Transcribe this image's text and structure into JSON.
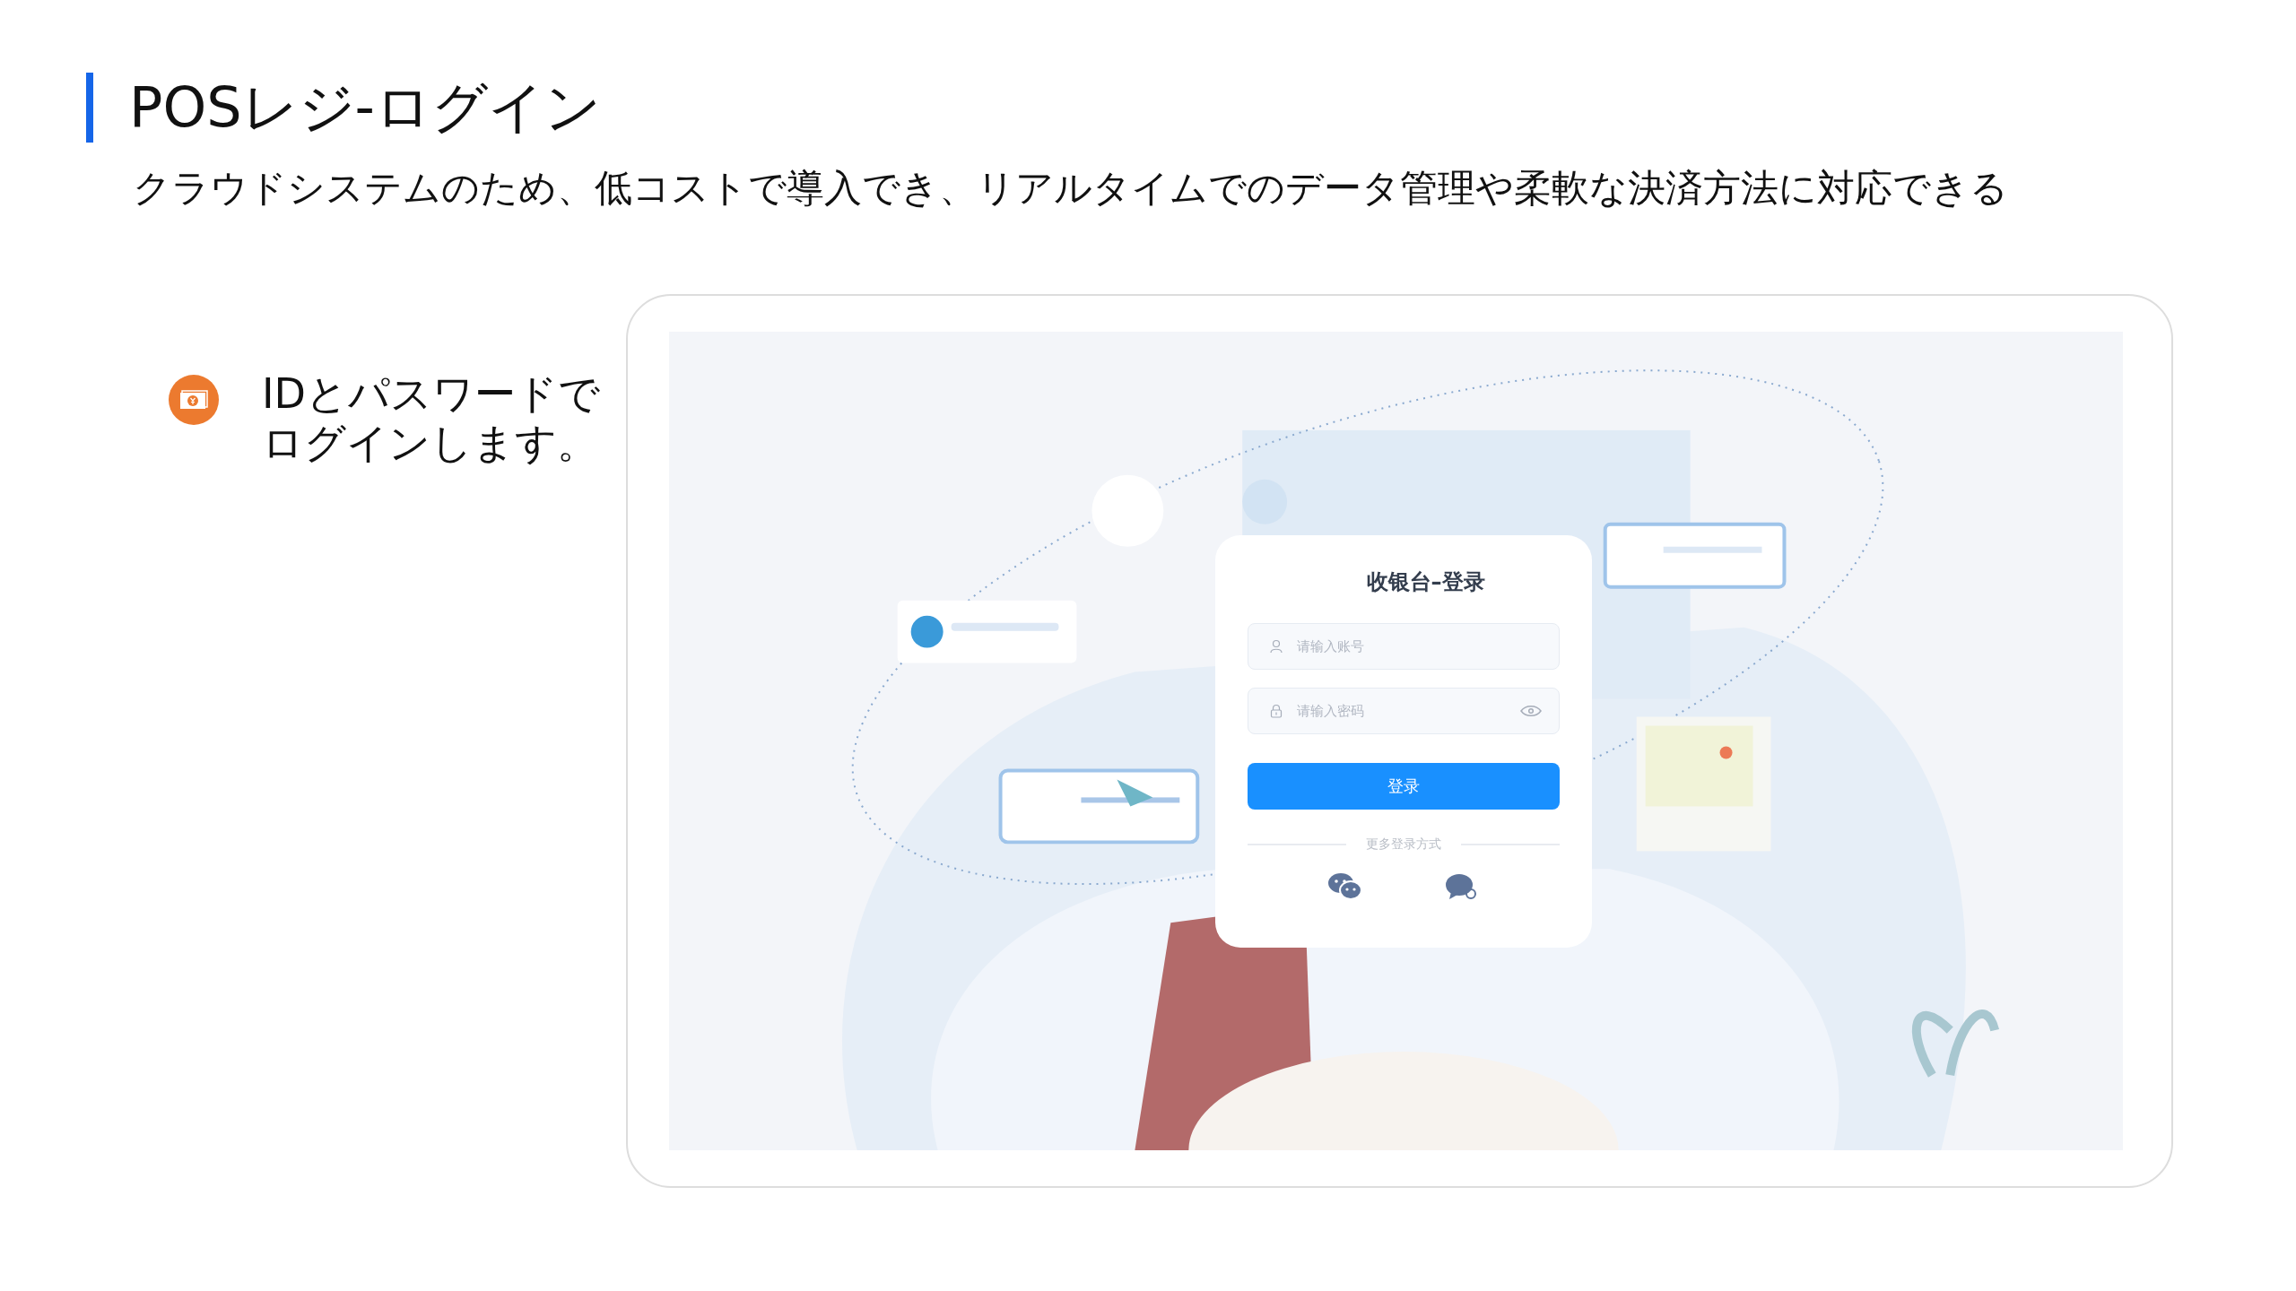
{
  "slide": {
    "title": "POSレジ-ログイン",
    "subtitle": "クラウドシステムのため、低コストで導入でき、リアルタイムでのデータ管理や柔軟な決済方法に対応できる"
  },
  "feature": {
    "text": "IDとパスワードでログインします。"
  },
  "login": {
    "title": "收银台–登录",
    "fields": [
      {
        "kind": "account",
        "placeholder": "请输入账号"
      },
      {
        "kind": "password",
        "placeholder": "请输入密码"
      }
    ],
    "submit": "登录",
    "divider": "更多登录方式",
    "alternatives": [
      {
        "kind": "wechat"
      },
      {
        "kind": "chat"
      }
    ]
  }
}
